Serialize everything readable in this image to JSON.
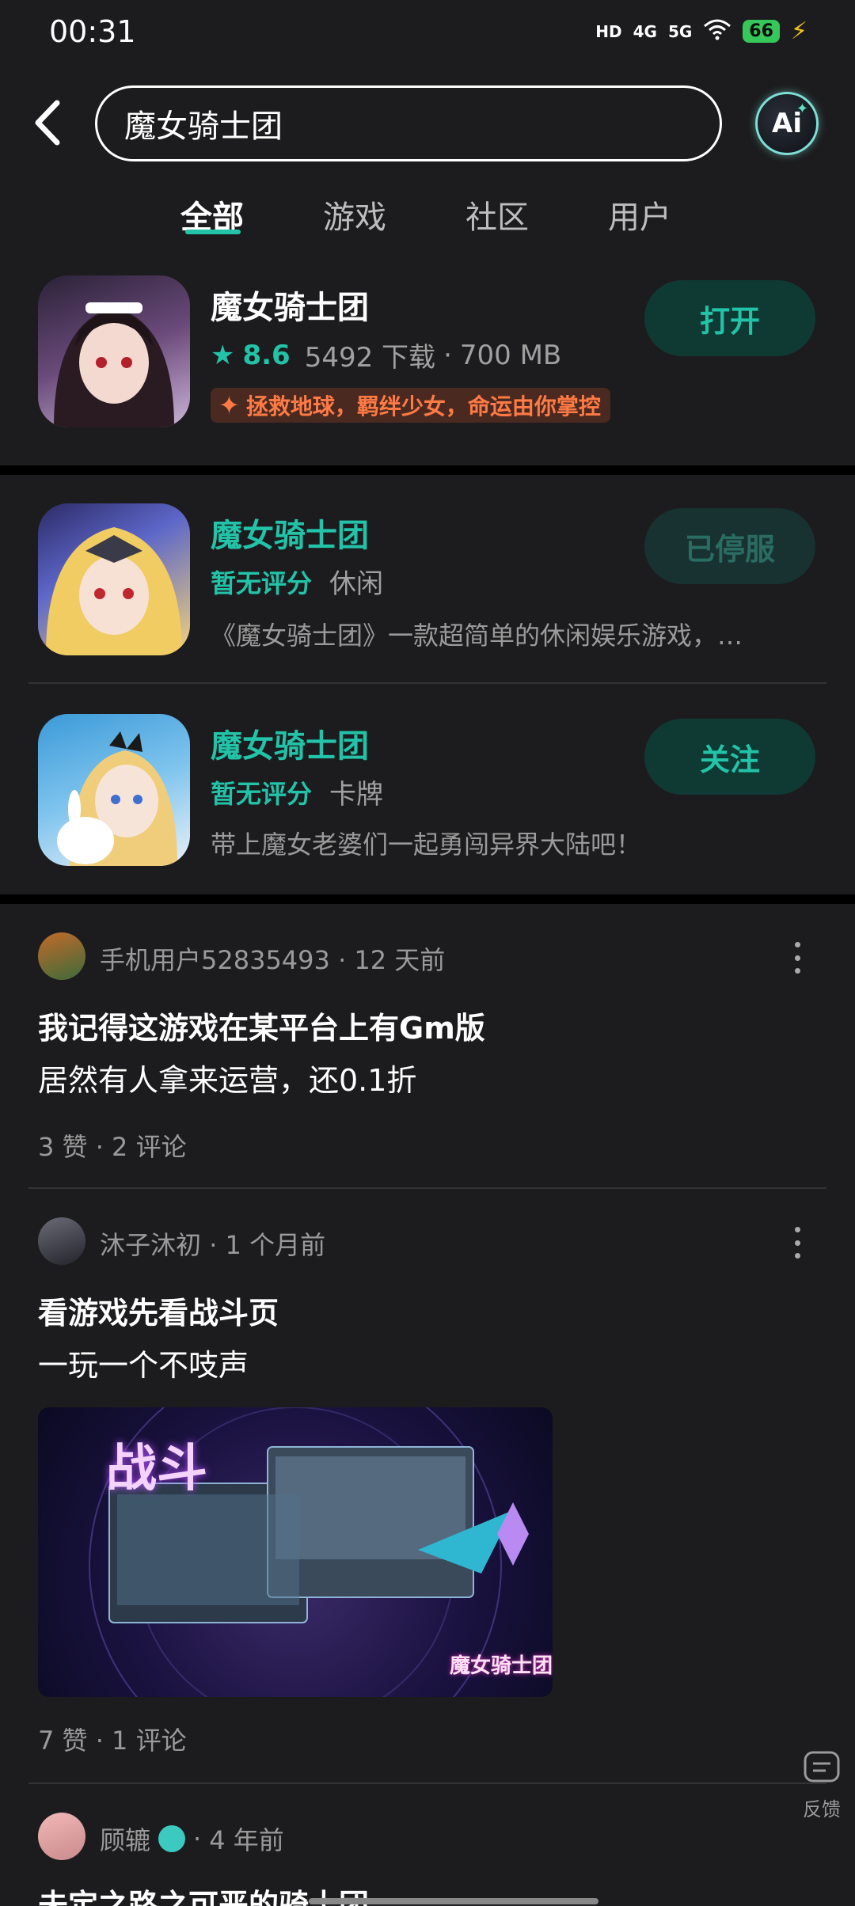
{
  "status_bar": {
    "time": "00:31",
    "network": "HD",
    "net1": "4G",
    "net2": "5G",
    "battery": "66"
  },
  "search": {
    "query": "魔女骑士团",
    "ai_label": "Ai"
  },
  "tabs": [
    {
      "label": "全部",
      "active": true
    },
    {
      "label": "游戏",
      "active": false
    },
    {
      "label": "社区",
      "active": false
    },
    {
      "label": "用户",
      "active": false
    }
  ],
  "apps": [
    {
      "title": "魔女骑士团",
      "rating": "8.6",
      "downloads": "5492 下载",
      "size": "700 MB",
      "tag": "拯救地球，羁绊少女，命运由你掌控",
      "button": "打开"
    },
    {
      "title": "魔女骑士团",
      "score": "暂无评分",
      "category": "休闲",
      "desc": "《魔女骑士团》一款超简单的休闲娱乐游戏，…",
      "button": "已停服"
    },
    {
      "title": "魔女骑士团",
      "score": "暂无评分",
      "category": "卡牌",
      "desc": "带上魔女老婆们一起勇闯异界大陆吧！",
      "button": "关注"
    }
  ],
  "posts": [
    {
      "author": "手机用户52835493",
      "time": "12 天前",
      "title": "我记得这游戏在某平台上有Gm版",
      "body": "居然有人拿来运营，还0.1折",
      "counts": "3 赞 · 2 评论"
    },
    {
      "author": "沐子沐初",
      "time": "1 个月前",
      "title": "看游戏先看战斗页",
      "body": "一玩一个不吱声",
      "image_caption": "战斗",
      "image_watermark": "魔女骑士团",
      "counts": "7 赞 · 1 评论"
    },
    {
      "author": "顾辘",
      "time": "4 年前",
      "title": "未定之路之可恶的骑士团"
    }
  ],
  "feedback_label": "反馈",
  "colors": {
    "accent": "#22c3a8",
    "background": "#1c1c1e",
    "tag_text": "#ff7a45"
  }
}
